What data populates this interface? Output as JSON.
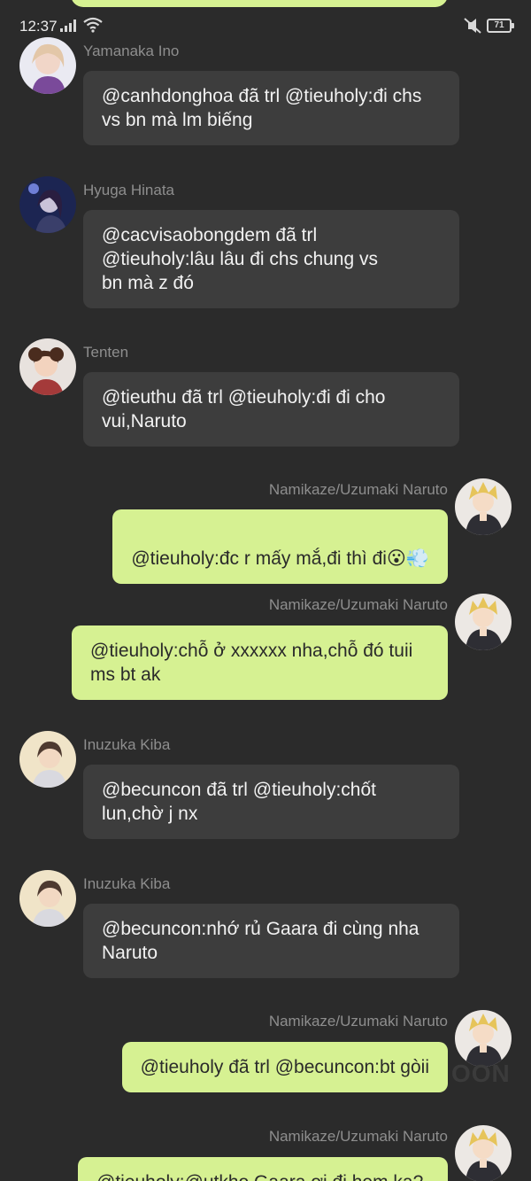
{
  "status_bar": {
    "time": "12:37",
    "battery": "71",
    "icons": [
      "signal-icon",
      "wifi-icon",
      "mute-icon",
      "battery-icon"
    ]
  },
  "messages": [
    {
      "sender": "Yamanaka Ino",
      "side": "in",
      "text": "@canhdonghoa đã trl @tieuholy:đi chs vs bn mà lm biếng"
    },
    {
      "sender": "Hyuga Hinata",
      "side": "in",
      "text": "@cacvisaobongdem đã trl @tieuholy:lâu lâu đi chs chung vs bn mà z đó"
    },
    {
      "sender": "Tenten",
      "side": "in",
      "text": "@tieuthu đã trl @tieuholy:đi đi cho vui,Naruto"
    },
    {
      "sender": "Namikaze/Uzumaki Naruto",
      "side": "out",
      "text": "@tieuholy:đc r mấy mắ,đi thì đi",
      "emojis": [
        "😮",
        "💨"
      ]
    },
    {
      "sender": "Namikaze/Uzumaki Naruto",
      "side": "out",
      "text": "@tieuholy:chỗ ở xxxxxx nha,chỗ đó tuii ms bt ak"
    },
    {
      "sender": "Inuzuka Kiba",
      "side": "in",
      "text": "@becuncon đã trl @tieuholy:chốt lun,chờ j nx"
    },
    {
      "sender": "Inuzuka Kiba",
      "side": "in",
      "text": "@becuncon:nhớ rủ Gaara đi cùng nha Naruto"
    },
    {
      "sender": "Namikaze/Uzumaki Naruto",
      "side": "out",
      "text": "@tieuholy đã trl @becuncon:bt gòii"
    },
    {
      "sender": "Namikaze/Uzumaki Naruto",
      "side": "out",
      "text": "@tieuholy:@utkho Gaara ơi đi hem ka?"
    }
  ],
  "watermark": "OON"
}
